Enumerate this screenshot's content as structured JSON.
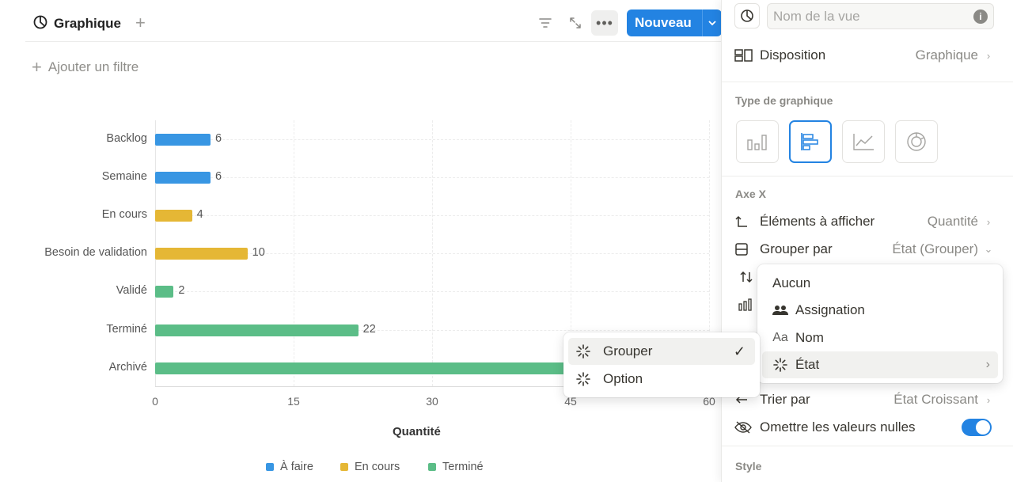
{
  "header": {
    "view_name": "Graphique",
    "new_button": "Nouveau",
    "add_filter": "Ajouter un filtre"
  },
  "chart_data": {
    "type": "bar",
    "orientation": "horizontal",
    "categories": [
      "Backlog",
      "Semaine",
      "En cours",
      "Besoin de validation",
      "Validé",
      "Terminé",
      "Archivé"
    ],
    "values": [
      6,
      6,
      4,
      10,
      2,
      22,
      60
    ],
    "bar_series": [
      "À faire",
      "À faire",
      "En cours",
      "En cours",
      "Terminé",
      "Terminé",
      "Terminé"
    ],
    "series": [
      {
        "name": "À faire",
        "color": "#3896e3"
      },
      {
        "name": "En cours",
        "color": "#e5b735"
      },
      {
        "name": "Terminé",
        "color": "#5bbd87"
      }
    ],
    "x_ticks": [
      "0",
      "15",
      "30",
      "45",
      "60"
    ],
    "xlim": [
      0,
      60
    ],
    "xlabel": "Quantité",
    "ylabel": "",
    "grid": true,
    "legend_position": "bottom"
  },
  "panel": {
    "name_placeholder": "Nom de la vue",
    "layout_label": "Disposition",
    "layout_value": "Graphique",
    "chart_type_section": "Type de graphique",
    "chart_types": [
      "vertical-bar-chart-icon",
      "horizontal-bar-chart-icon",
      "line-chart-icon",
      "donut-chart-icon"
    ],
    "selected_chart_type": 1,
    "x_axis_section": "Axe X",
    "show_label": "Éléments à afficher",
    "show_value": "Quantité",
    "group_label": "Grouper par",
    "group_value": "État (Grouper)",
    "sort_label": "Trier par",
    "sort_value": "État Croissant",
    "omit_label": "Omettre les valeurs nulles",
    "omit_enabled": true,
    "style_section": "Style"
  },
  "group_menu": {
    "items": [
      {
        "label": "Aucun",
        "icon": ""
      },
      {
        "label": "Assignation",
        "icon": "people-icon"
      },
      {
        "label": "Nom",
        "icon": "text-aa-icon",
        "glyph": "Aa"
      },
      {
        "label": "État",
        "icon": "status-icon",
        "has_submenu": true,
        "highlighted": true
      }
    ]
  },
  "state_submenu": {
    "items": [
      {
        "label": "Grouper",
        "icon": "status-icon",
        "checked": true,
        "check": "✓"
      },
      {
        "label": "Option",
        "icon": "status-icon"
      }
    ]
  },
  "colors": {
    "accent": "#2383e2"
  }
}
